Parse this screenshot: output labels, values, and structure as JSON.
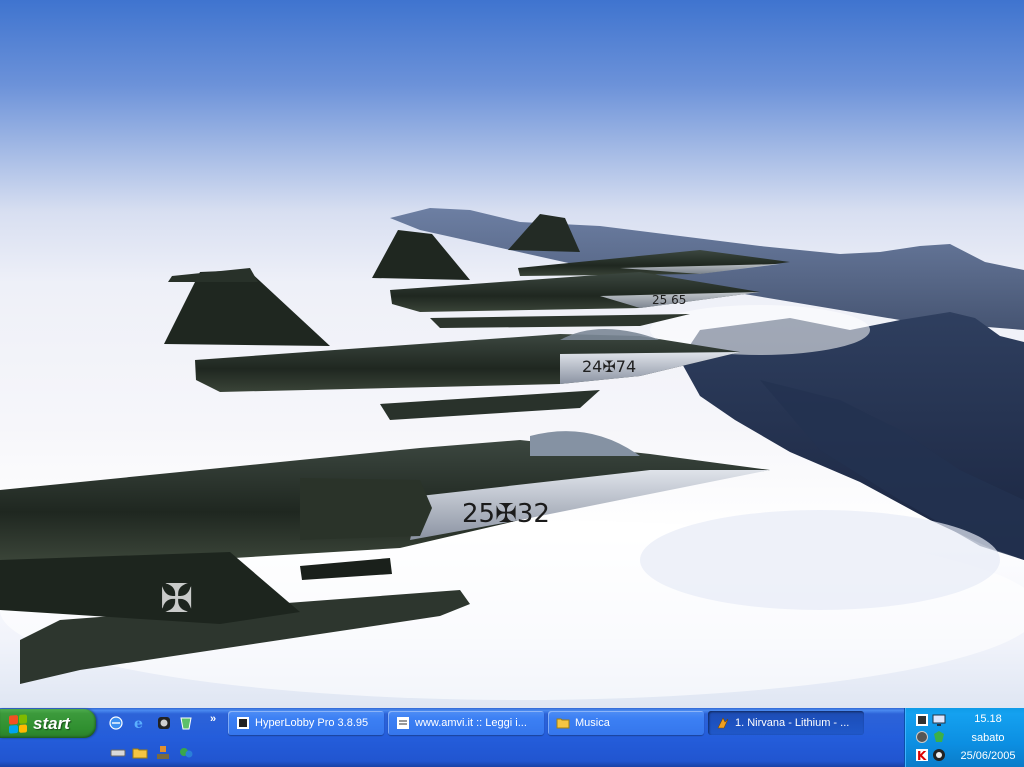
{
  "start": {
    "label": "start"
  },
  "quick_launch": [
    {
      "name": "internet-explorer-icon"
    },
    {
      "name": "e-icon"
    },
    {
      "name": "media-player-icon"
    },
    {
      "name": "recycle-icon"
    },
    {
      "name": "drive-icon"
    },
    {
      "name": "folder-icon"
    },
    {
      "name": "network-icon"
    },
    {
      "name": "messenger-icon"
    }
  ],
  "quick_launch_expand": "»",
  "tasks": [
    {
      "label": "HyperLobby Pro 3.8.95",
      "icon": "hyperlobby-icon",
      "active": false
    },
    {
      "label": "www.amvi.it :: Leggi i...",
      "icon": "browser-icon",
      "active": false
    },
    {
      "label": "Musica",
      "icon": "folder-icon",
      "active": false
    },
    {
      "label": "1. Nirvana - Lithium - ...",
      "icon": "winamp-icon",
      "active": true
    }
  ],
  "tray": {
    "icons": [
      "network-tray-icon",
      "monitor-tray-icon",
      "volume-tray-icon",
      "security-tray-icon",
      "antivirus-tray-icon",
      "messenger-tray-icon"
    ],
    "time": "15.18",
    "day": "sabato",
    "date": "25/06/2005"
  },
  "colors": {
    "sky": "#3f74cf",
    "taskbar": "#245ddb",
    "start_green": "#2f8f2f",
    "tray": "#0c8fe2"
  }
}
